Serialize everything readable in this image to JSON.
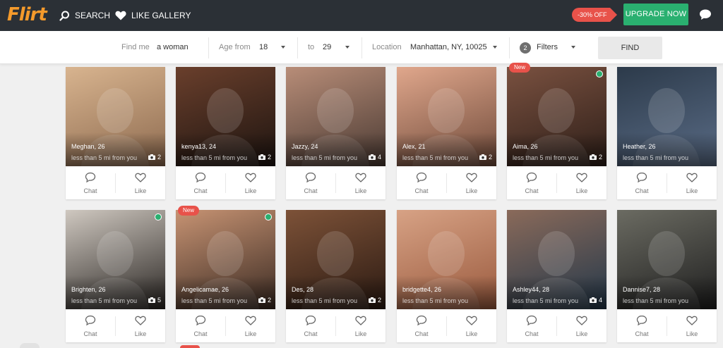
{
  "header": {
    "logo": "Flirt",
    "search_label": "SEARCH",
    "gallery_label": "LIKE GALLERY",
    "discount": "-30% OFF",
    "upgrade_label": "UPGRADE NOW",
    "colors": {
      "bar": "#2b3036",
      "accent": "#2ab070",
      "logo": "#f59a2b",
      "discount": "#e8524a"
    }
  },
  "filters": {
    "find_me_label": "Find me",
    "find_me_value": "a woman",
    "age_from_label": "Age from",
    "age_from_value": "18",
    "age_to_label": "to",
    "age_to_value": "29",
    "location_label": "Location",
    "location_value": "Manhattan, NY, 10025",
    "filters_count": "2",
    "filters_label": "Filters",
    "find_button": "FIND"
  },
  "card_actions": {
    "chat": "Chat",
    "like": "Like"
  },
  "profiles": [
    {
      "name": "Meghan",
      "age": "26",
      "distance": "less than 5 mi from you",
      "photos": "2",
      "online": false,
      "new": false,
      "bg": [
        "#8d6a4f",
        "#d8b48f"
      ]
    },
    {
      "name": "kenya13",
      "age": "24",
      "distance": "less than 5 mi from you",
      "photos": "2",
      "online": false,
      "new": false,
      "bg": [
        "#1d1410",
        "#6a3f2c"
      ]
    },
    {
      "name": "Jazzy",
      "age": "24",
      "distance": "less than 5 mi from you",
      "photos": "4",
      "online": false,
      "new": false,
      "bg": [
        "#4a3a33",
        "#b88d78"
      ]
    },
    {
      "name": "Alex",
      "age": "21",
      "distance": "less than 5 mi from you",
      "photos": "2",
      "online": false,
      "new": false,
      "bg": [
        "#6f4a3a",
        "#e0a78c"
      ]
    },
    {
      "name": "Aima",
      "age": "26",
      "distance": "less than 5 mi from you",
      "photos": "2",
      "online": true,
      "new": true,
      "new_label": "New",
      "bg": [
        "#2d1e18",
        "#7a5140"
      ]
    },
    {
      "name": "Heather",
      "age": "26",
      "distance": "less than 5 mi from you",
      "photos": "",
      "online": false,
      "new": false,
      "bg": [
        "#5a6c86",
        "#2c3a4a"
      ]
    },
    {
      "name": "Brighten",
      "age": "26",
      "distance": "less than 5 mi from you",
      "photos": "5",
      "online": true,
      "new": false,
      "bg": [
        "#2a2623",
        "#cfc8c0"
      ]
    },
    {
      "name": "Angelicamae",
      "age": "26",
      "distance": "less than 5 mi from you",
      "photos": "2",
      "online": true,
      "new": true,
      "new_label": "New",
      "bg": [
        "#3a2a22",
        "#c79373"
      ]
    },
    {
      "name": "Des",
      "age": "28",
      "distance": "less than 5 mi from you",
      "photos": "2",
      "online": false,
      "new": false,
      "bg": [
        "#2b1a12",
        "#7d5238"
      ]
    },
    {
      "name": "bridgette4",
      "age": "26",
      "distance": "less than 5 mi from you",
      "photos": "",
      "online": false,
      "new": false,
      "bg": [
        "#9a5a3e",
        "#d7a285"
      ]
    },
    {
      "name": "Ashley44",
      "age": "28",
      "distance": "less than 5 mi from you",
      "photos": "4",
      "online": false,
      "new": false,
      "bg": [
        "#24384a",
        "#8a6a5a"
      ]
    },
    {
      "name": "Dannise7",
      "age": "28",
      "distance": "less than 5 mi from you",
      "photos": "",
      "online": false,
      "new": false,
      "bg": [
        "#1f1f1f",
        "#6b6b62"
      ]
    }
  ]
}
